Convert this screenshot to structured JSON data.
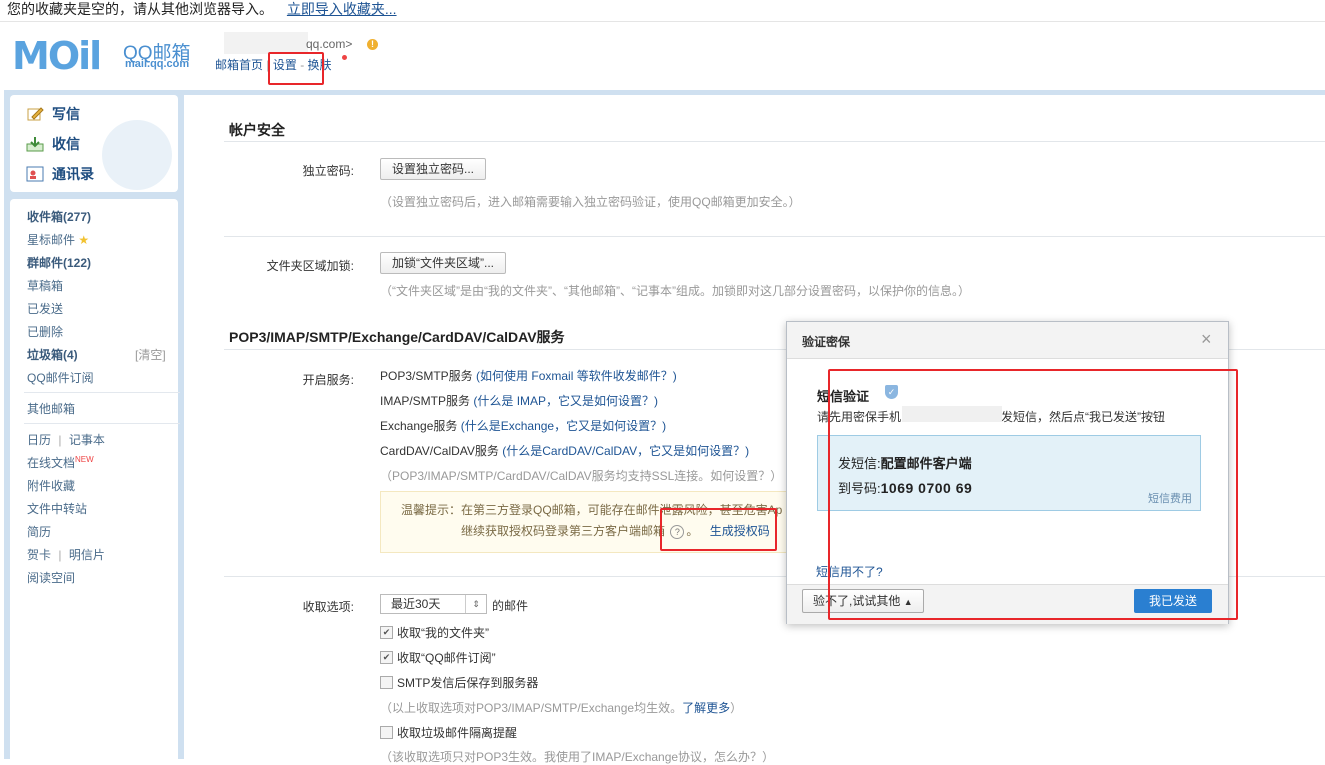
{
  "notice": {
    "text": "您的收藏夹是空的，请从其他浏览器导入。",
    "link": "立即导入收藏夹..."
  },
  "header": {
    "logo_text": "MOil",
    "brand": "QQ邮箱",
    "brand_url": "mail.qq.com",
    "account": "qq.com>",
    "links": {
      "home": "邮箱首页",
      "settings": "设置",
      "dash": "-",
      "skin": "换肤",
      "divider": "|"
    }
  },
  "nav": {
    "actions": [
      {
        "label": "写信",
        "icon": "write-icon"
      },
      {
        "label": "收信",
        "icon": "receive-icon"
      },
      {
        "label": "通讯录",
        "icon": "contacts-icon"
      }
    ],
    "folders": {
      "inbox": "收件箱(277)",
      "starred": "星标邮件",
      "group": "群邮件(122)",
      "drafts": "草稿箱",
      "sent": "已发送",
      "deleted": "已删除",
      "spam": "垃圾箱(4)",
      "spam_clear": "[清空]",
      "subscriptions": "QQ邮件订阅",
      "other_mail": "其他邮箱",
      "calendar": "日历",
      "notebook": "记事本",
      "online_docs": "在线文档",
      "new_badge": "NEW",
      "attachments": "附件收藏",
      "transfer": "文件中转站",
      "resume": "简历",
      "cards": "贺卡",
      "postcards": "明信片",
      "reading": "阅读空间",
      "pipe": "|"
    }
  },
  "main": {
    "account_security": {
      "title": "帐户安全",
      "pwd_label": "独立密码:",
      "pwd_button": "设置独立密码...",
      "pwd_hint": "（设置独立密码后，进入邮箱需要输入独立密码验证，使用QQ邮箱更加安全。）",
      "lock_label": "文件夹区域加锁:",
      "lock_button": "加锁“文件夹区域”...",
      "lock_hint": "（“文件夹区域”是由“我的文件夹”、“其他邮箱”、“记事本”组成。加锁即对这几部分设置密码，以保护你的信息。）"
    },
    "services": {
      "title": "POP3/IMAP/SMTP/Exchange/CardDAV/CalDAV服务",
      "enable_label": "开启服务:",
      "pop3": "POP3/SMTP服务",
      "pop3_q": "(如何使用 Foxmail 等软件收发邮件？)",
      "imap": "IMAP/SMTP服务",
      "imap_q": "(什么是 IMAP，它又是如何设置？)",
      "exchange": "Exchange服务",
      "exchange_q": "(什么是Exchange，它又是如何设置？)",
      "carddav": "CardDAV/CalDAV服务",
      "carddav_q": "(什么是CardDAV/CalDAV，它又是如何设置？)",
      "ssl_hint": "（POP3/IMAP/SMTP/CardDAV/CalDAV服务均支持SSL连接。如何设置？）",
      "tip_line1": "温馨提示：在第三方登录QQ邮箱，可能存在邮件泄露风险，甚至危害Ap",
      "tip_line2": "继续获取授权码登录第三方客户端邮箱",
      "tip_q": "?",
      "tip_period": "。",
      "gen_code": "生成授权码"
    },
    "receive": {
      "label": "收取选项:",
      "select_value": "最近30天",
      "suffix": "的邮件",
      "opt1": "收取“我的文件夹”",
      "opt2": "收取“QQ邮件订阅”",
      "opt3": "SMTP发信后保存到服务器",
      "hint1": "（以上收取选项对POP3/IMAP/SMTP/Exchange均生效。",
      "hint1_link": "了解更多",
      "hint1_end": "）",
      "opt4": "收取垃圾邮件隔离提醒",
      "hint2": "（该收取选项只对POP3生效。我使用了IMAP/Exchange协议，怎么办？）"
    }
  },
  "dialog": {
    "title": "验证密保",
    "close": "×",
    "subtitle": "短信验证",
    "desc_a": "请先用密保手机",
    "desc_b": "发短信，然后点“我已发送”按钮",
    "sms_label": "发短信:",
    "sms_content": "配置邮件客户端",
    "to_label": "到号码:",
    "to_number": "1069 0700 69",
    "fee": "短信费用",
    "cant_use": "短信用不了?",
    "other_button": "验不了,试试其他",
    "sent_button": "我已发送"
  },
  "colors": {
    "accent": "#2a7fd1",
    "highlight": "#e8262a",
    "frame": "#cfe0f0"
  }
}
